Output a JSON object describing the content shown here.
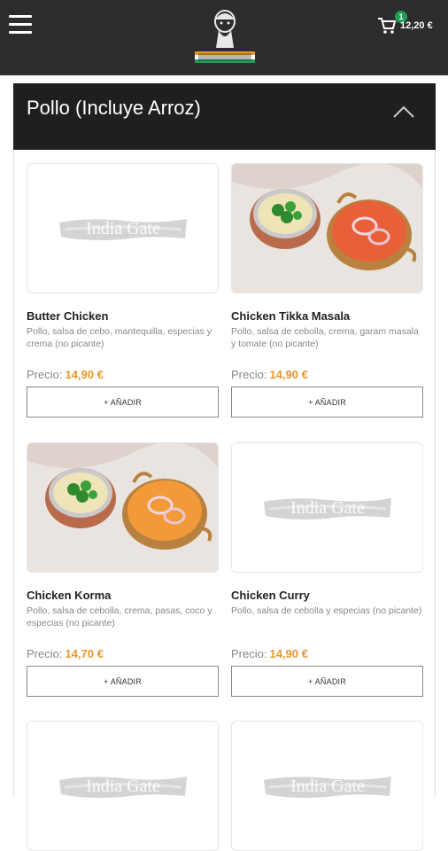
{
  "header": {
    "cart_count": "1",
    "cart_total": "12,20 €"
  },
  "section": {
    "title": "Pollo (Incluye Arroz)"
  },
  "placeholder_text": "India Gate",
  "price_label": "Precio:",
  "products": [
    {
      "name": "Butter Chicken",
      "desc": "Pollo, salsa de cebo, mantequilla, especias y crema (no picante)",
      "price": "14,90 €",
      "add_label": "+ AÑADIR",
      "image": "placeholder"
    },
    {
      "name": "Chicken Tikka Masala",
      "desc": "Pollo, salsa de cebolla, crema, garam masala y tomate (no picante)",
      "price": "14,90 €",
      "add_label": "+ AÑADIR",
      "image": "photo"
    },
    {
      "name": "Chicken Korma",
      "desc": "Pollo, salsa de cebolla, crema, pasas, coco y especias (no picante)",
      "price": "14,70 €",
      "add_label": "+ AÑADIR",
      "image": "photo"
    },
    {
      "name": "Chicken Curry",
      "desc": "Pollo, salsa de cebolla y especias (no picante)",
      "price": "14,90 €",
      "add_label": "+ AÑADIR",
      "image": "placeholder"
    },
    {
      "image": "placeholder"
    },
    {
      "image": "placeholder"
    }
  ],
  "colors": {
    "topbar": "#2b2d2f",
    "section_header": "#1e1f21",
    "price_accent": "#e8962e",
    "badge": "#1f9d55"
  },
  "icons": [
    "menu-icon",
    "cart-icon",
    "chevron-up-icon",
    "restaurant-logo"
  ]
}
